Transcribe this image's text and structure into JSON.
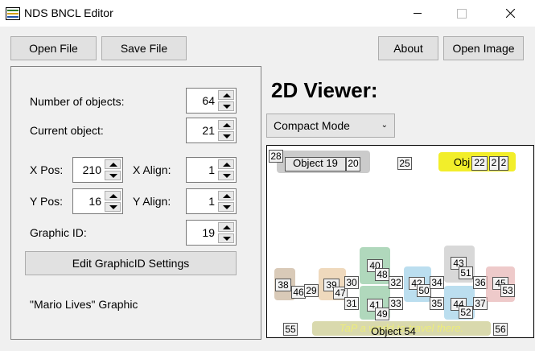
{
  "window": {
    "title": "NDS BNCL Editor"
  },
  "toolbar": {
    "open_file": "Open File",
    "save_file": "Save File",
    "about": "About",
    "open_image": "Open Image"
  },
  "fields": {
    "num_objects": {
      "label": "Number of objects:",
      "value": "64"
    },
    "current_object": {
      "label": "Current object:",
      "value": "21"
    },
    "x_pos": {
      "label": "X Pos:",
      "value": "210"
    },
    "x_align": {
      "label": "X Align:",
      "value": "1"
    },
    "y_pos": {
      "label": "Y Pos:",
      "value": "16"
    },
    "y_align": {
      "label": "Y Align:",
      "value": "1"
    },
    "graphic_id": {
      "label": "Graphic ID:",
      "value": "19"
    }
  },
  "edit_graphic_button": "Edit GraphicID Settings",
  "graphic_name": "\"Mario Lives\" Graphic",
  "viewer": {
    "title": "2D Viewer:",
    "mode": "Compact Mode",
    "labels": {
      "o28": "28",
      "o19": "Object 19",
      "o20": "20",
      "o25": "25",
      "obj": "Obj",
      "o22": "22",
      "o2a": "2",
      "o2b": "2",
      "o38": "38",
      "o46": "46",
      "o29": "29",
      "o39": "39",
      "o47": "47",
      "o30": "30",
      "o31": "31",
      "o40": "40",
      "o48": "48",
      "o41": "41",
      "o49": "49",
      "o32": "32",
      "o33": "33",
      "o42": "42",
      "o50": "50",
      "o34": "34",
      "o35": "35",
      "o43": "43",
      "o51": "51",
      "o44": "44",
      "o52": "52",
      "o36": "36",
      "o37": "37",
      "o45": "45",
      "o53": "53",
      "o55": "55",
      "o54": "Object 54",
      "o56": "56",
      "banner": "TaP a world to travel there."
    }
  }
}
